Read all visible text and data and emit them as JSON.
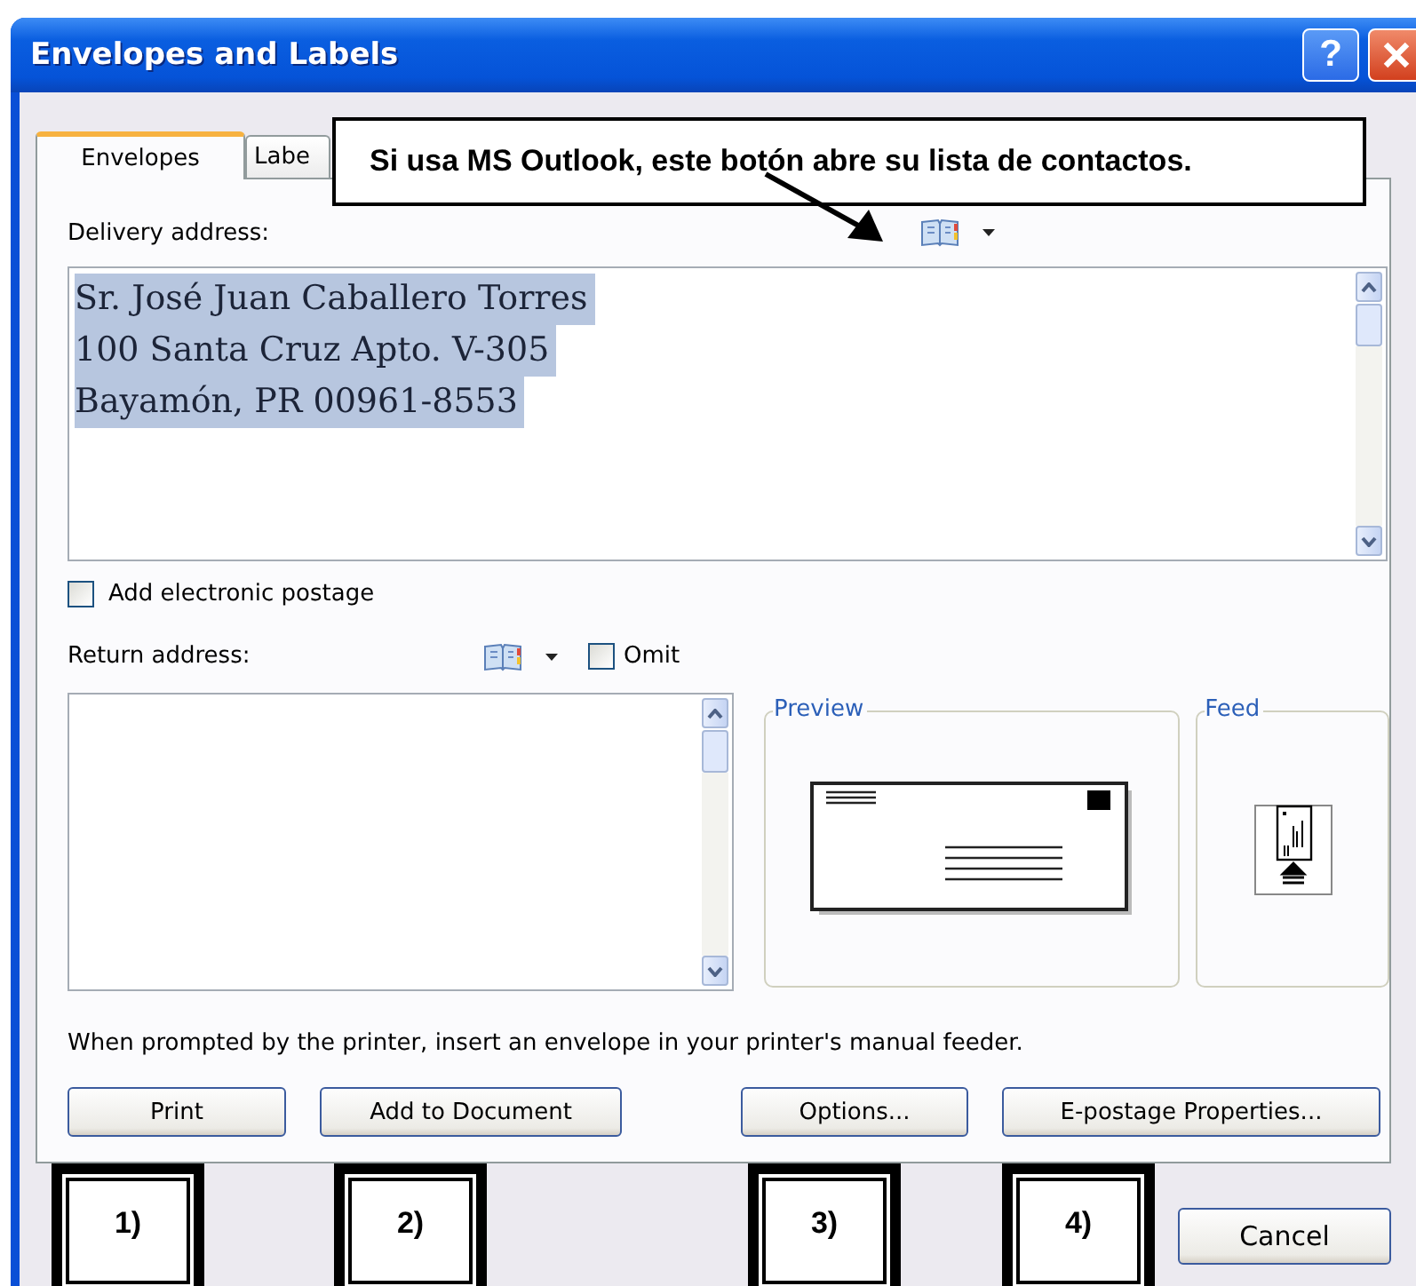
{
  "window": {
    "title": "Envelopes and Labels",
    "help": "?"
  },
  "callout": {
    "text": "Si usa MS Outlook, este botón abre su lista de contactos."
  },
  "tabs": [
    {
      "label": "Envelopes",
      "selected": true
    },
    {
      "label": "Labe",
      "selected": false
    }
  ],
  "delivery": {
    "label": "Delivery address:",
    "text_selected": true,
    "lines": [
      "Sr. José Juan Caballero Torres",
      "100 Santa Cruz Apto. V-305",
      "Bayamón, PR 00961-8553"
    ]
  },
  "electronic_postage": {
    "label": "Add electronic postage",
    "checked": false
  },
  "return_address": {
    "label": "Return address:",
    "omit": {
      "label": "Omit",
      "checked": false
    }
  },
  "preview": {
    "title": "Preview"
  },
  "feed": {
    "title": "Feed"
  },
  "instructions": "When prompted by the printer, insert an envelope in your printer's manual feeder.",
  "buttons": [
    "Print",
    "Add to Document",
    "Options...",
    "E-postage Properties..."
  ],
  "markers": [
    "1)",
    "2)",
    "3)",
    "4)"
  ],
  "cancel": "Cancel"
}
